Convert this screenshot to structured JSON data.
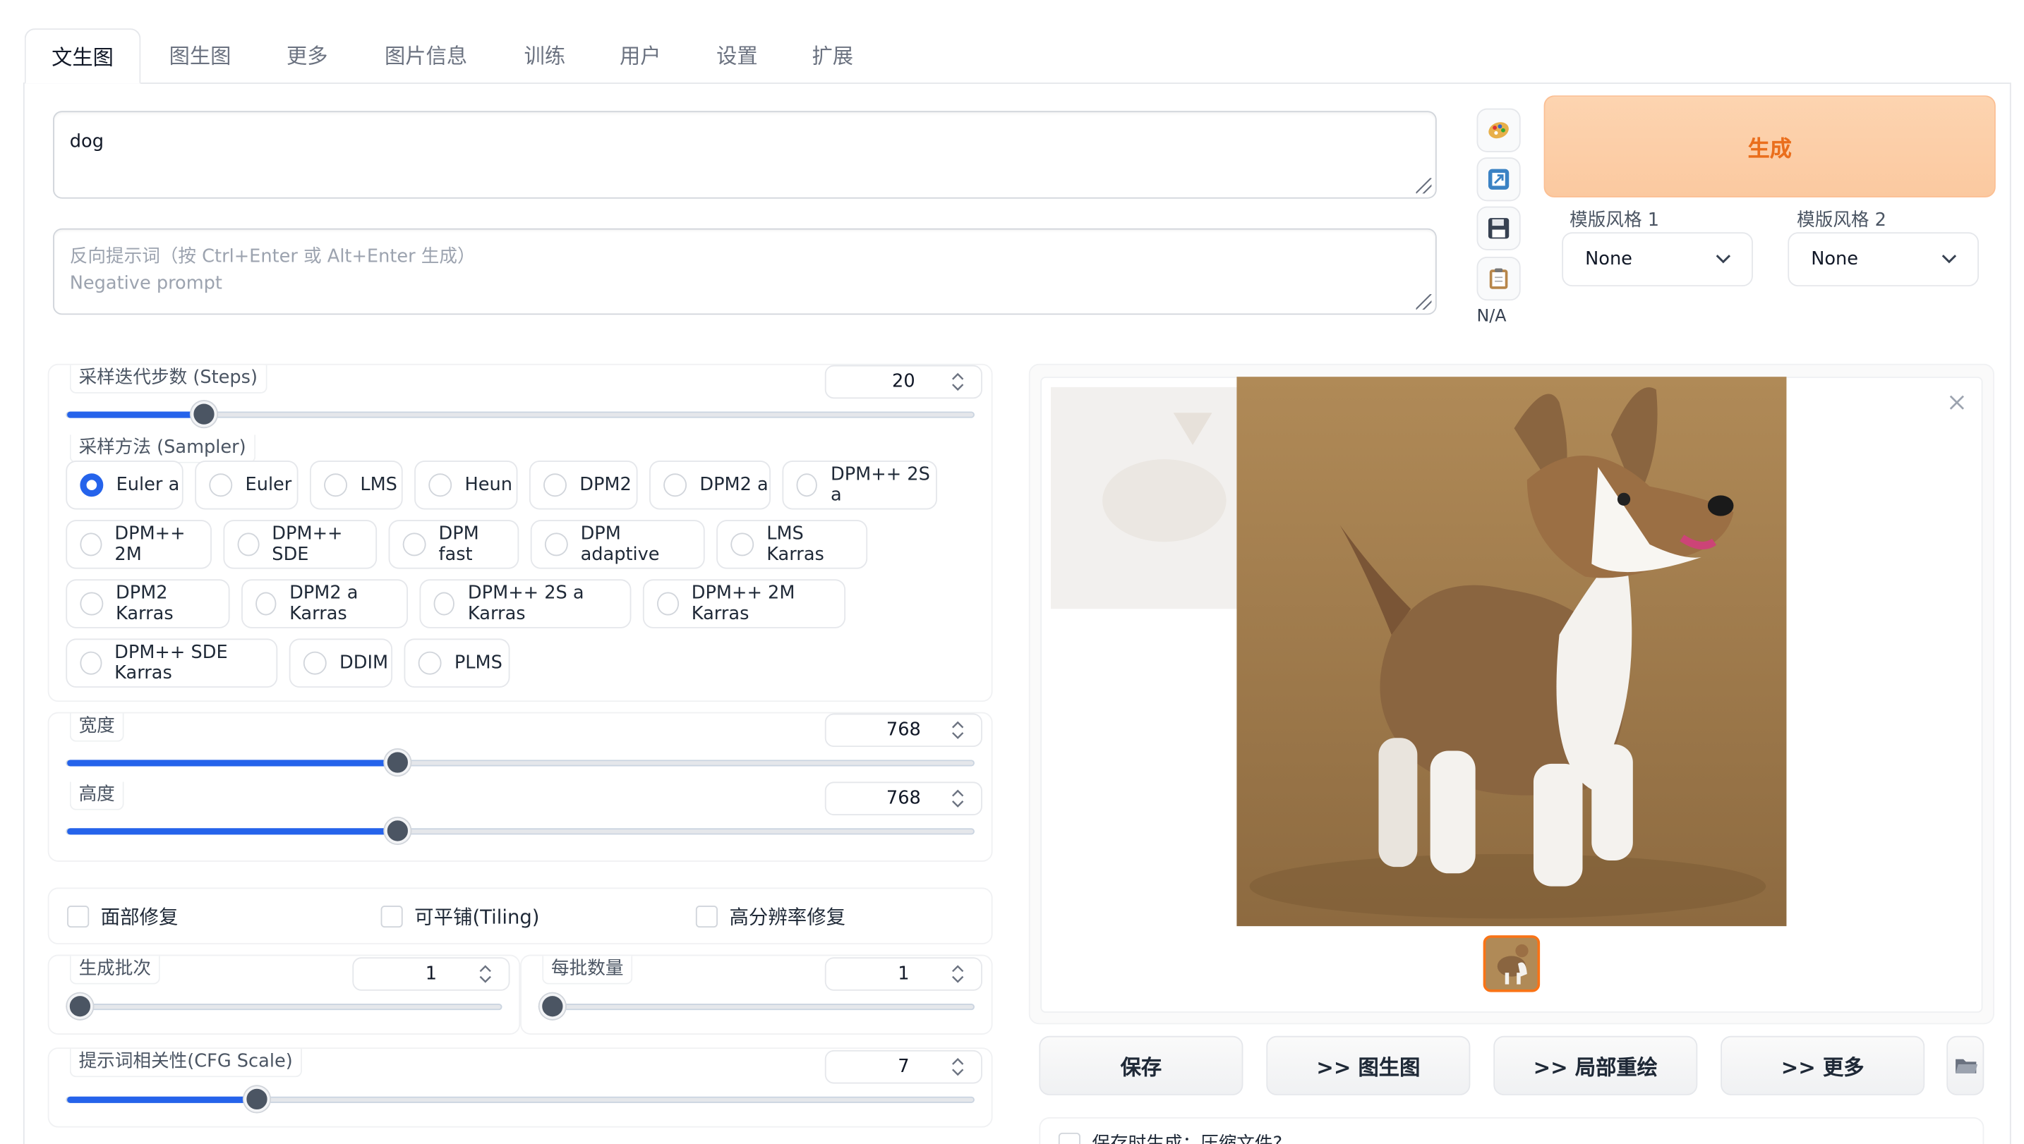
{
  "tabs": [
    "文生图",
    "图生图",
    "更多",
    "图片信息",
    "训练",
    "用户",
    "设置",
    "扩展"
  ],
  "prompt": {
    "value": "dog",
    "negative_placeholder_line1": "反向提示词（按 Ctrl+Enter 或 Alt+Enter 生成）",
    "negative_placeholder_line2": "Negative prompt"
  },
  "tools": {
    "token_count": "N/A",
    "icons": [
      "palette-icon",
      "arrow-out-icon",
      "save-icon",
      "clipboard-icon"
    ]
  },
  "generate_label": "生成",
  "styles": [
    {
      "label": "模版风格 1",
      "value": "None"
    },
    {
      "label": "模版风格 2",
      "value": "None"
    }
  ],
  "steps": {
    "label": "采样迭代步数 (Steps)",
    "value": "20",
    "slider_fraction": 0.14
  },
  "sampler": {
    "label": "采样方法 (Sampler)",
    "selected": "Euler a",
    "options": [
      "Euler a",
      "Euler",
      "LMS",
      "Heun",
      "DPM2",
      "DPM2 a",
      "DPM++ 2S a",
      "DPM++ 2M",
      "DPM++ SDE",
      "DPM fast",
      "DPM adaptive",
      "LMS Karras",
      "DPM2 Karras",
      "DPM2 a Karras",
      "DPM++ 2S a Karras",
      "DPM++ 2M Karras",
      "DPM++ SDE Karras",
      "DDIM",
      "PLMS"
    ]
  },
  "width": {
    "label": "宽度",
    "value": "768",
    "slider_fraction": 0.359
  },
  "height": {
    "label": "高度",
    "value": "768",
    "slider_fraction": 0.359
  },
  "options": {
    "face_restore": "面部修复",
    "tiling": "可平铺(Tiling)",
    "hires_fix": "高分辨率修复"
  },
  "batch_count": {
    "label": "生成批次",
    "value": "1",
    "slider_fraction": 0
  },
  "batch_size": {
    "label": "每批数量",
    "value": "1",
    "slider_fraction": 0
  },
  "cfg": {
    "label": "提示词相关性(CFG Scale)",
    "value": "7",
    "slider_fraction": 0.2
  },
  "actions": {
    "save": "保存",
    "to_img2img": ">> 图生图",
    "to_inpaint": ">> 局部重绘",
    "to_extras": ">> 更多"
  },
  "bottom_partial": "保存时生成：压缩文件?",
  "colors": {
    "accent": "#2563eb",
    "generate_bg": "#fdd4b0",
    "generate_text": "#ea6e1c"
  }
}
